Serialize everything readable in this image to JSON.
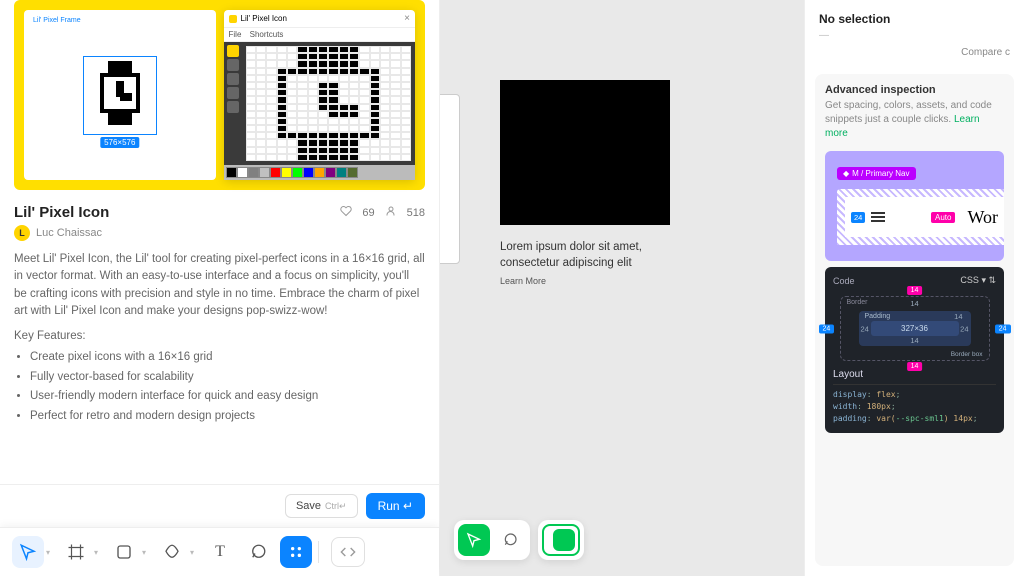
{
  "plugin": {
    "title": "Lil' Pixel Icon",
    "likes": "69",
    "users": "518",
    "author": "Luc Chaissac",
    "author_initial": "L",
    "description": "Meet Lil' Pixel Icon, the Lil' tool for creating pixel-perfect icons in a 16×16 grid, all in vector format. With an easy-to-use interface and a focus on simplicity, you'll be crafting icons with precision and style in no time. Embrace the charm of pixel art with Lil' Pixel Icon and make your designs pop-swizz-wow!",
    "features_title": "Key Features:",
    "features": [
      "Create pixel icons with a 16×16 grid",
      "Fully vector-based for scalability",
      "User-friendly modern interface for quick and easy design",
      "Perfect for retro and modern design projects"
    ],
    "save_label": "Save",
    "save_shortcut": "Ctrl↵",
    "run_label": "Run ↵",
    "frame_label": "Lil' Pixel Frame",
    "frame_size": "576×576",
    "editor": {
      "title": "Lil' Pixel Icon",
      "menu": [
        "File",
        "Shortcuts"
      ],
      "palette": [
        "#000000",
        "#ffffff",
        "#808080",
        "#c0c0c0",
        "#ff0000",
        "#ffff00",
        "#00ff00",
        "#0000ff",
        "#ffa500",
        "#800080",
        "#008080",
        "#556b2f"
      ]
    }
  },
  "canvas": {
    "caption": "Lorem ipsum dolor sit amet, consectetur adipiscing elit",
    "learn_more": "Learn More"
  },
  "inspector": {
    "no_selection": "No selection",
    "dash": "—",
    "compare": "Compare c",
    "card_title": "Advanced inspection",
    "card_desc": "Get spacing, colors, assets, and code snippets just a couple clicks. ",
    "learn_more": "Learn more",
    "tag": "M / Primary Nav",
    "m24_left": "24",
    "auto_badge": "Auto",
    "wor": "Wor",
    "code_tab": "Code",
    "lang": "CSS",
    "box": {
      "border_label": "Border",
      "padding_label": "Padding",
      "top_m": "14",
      "left_b": "24",
      "right_b": "24",
      "pad_top": "14",
      "pad_left": "24",
      "pad_right": "24",
      "content": "327×36",
      "pad_bottom": "14",
      "bottom_m": "14",
      "border_box_label": "Border box",
      "border_top": "14"
    },
    "layout_label": "Layout",
    "css": {
      "l1_prop": "display",
      "l1_val": "flex",
      "l2_prop": "width",
      "l2_val": "180px",
      "l3_prop": "padding",
      "l3a": "var(",
      "l3b": "--spc-sml1",
      "l3c": ") 14px"
    }
  }
}
